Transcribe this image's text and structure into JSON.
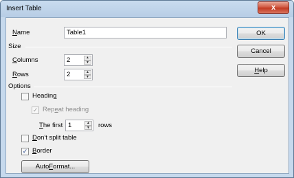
{
  "window": {
    "title": "Insert Table",
    "close_glyph": "x"
  },
  "name_field": {
    "label_mnemonic": "N",
    "label_rest": "ame",
    "value": "Table1"
  },
  "size_section": {
    "title": "Size",
    "columns": {
      "label_mnemonic": "C",
      "label_rest": "olumns",
      "value": "2"
    },
    "rows": {
      "label_mnemonic": "R",
      "label_rest": "ows",
      "value": "2"
    }
  },
  "options_section": {
    "title": "Options",
    "heading": {
      "label_pre": "Headin",
      "label_mnemonic": "g",
      "label_post": "",
      "checked": false
    },
    "repeat_heading": {
      "label_pre": "Rep",
      "label_mnemonic": "e",
      "label_post": "at heading",
      "checked": true,
      "enabled": false
    },
    "the_first": {
      "label_pre": "",
      "label_mnemonic": "T",
      "label_post": "he first",
      "value": "1",
      "suffix": "rows"
    },
    "dont_split": {
      "label_pre": "",
      "label_mnemonic": "D",
      "label_post": "on't split table",
      "checked": false
    },
    "border": {
      "label_pre": "",
      "label_mnemonic": "B",
      "label_post": "order",
      "checked": true
    }
  },
  "buttons": {
    "autoformat": {
      "label_pre": "Auto",
      "label_mnemonic": "F",
      "label_post": "ormat..."
    },
    "ok": "OK",
    "cancel": "Cancel",
    "help": {
      "label_mnemonic": "H",
      "label_rest": "elp"
    }
  },
  "glyphs": {
    "check": "✓",
    "spin_up": "▲",
    "spin_down": "▼"
  }
}
